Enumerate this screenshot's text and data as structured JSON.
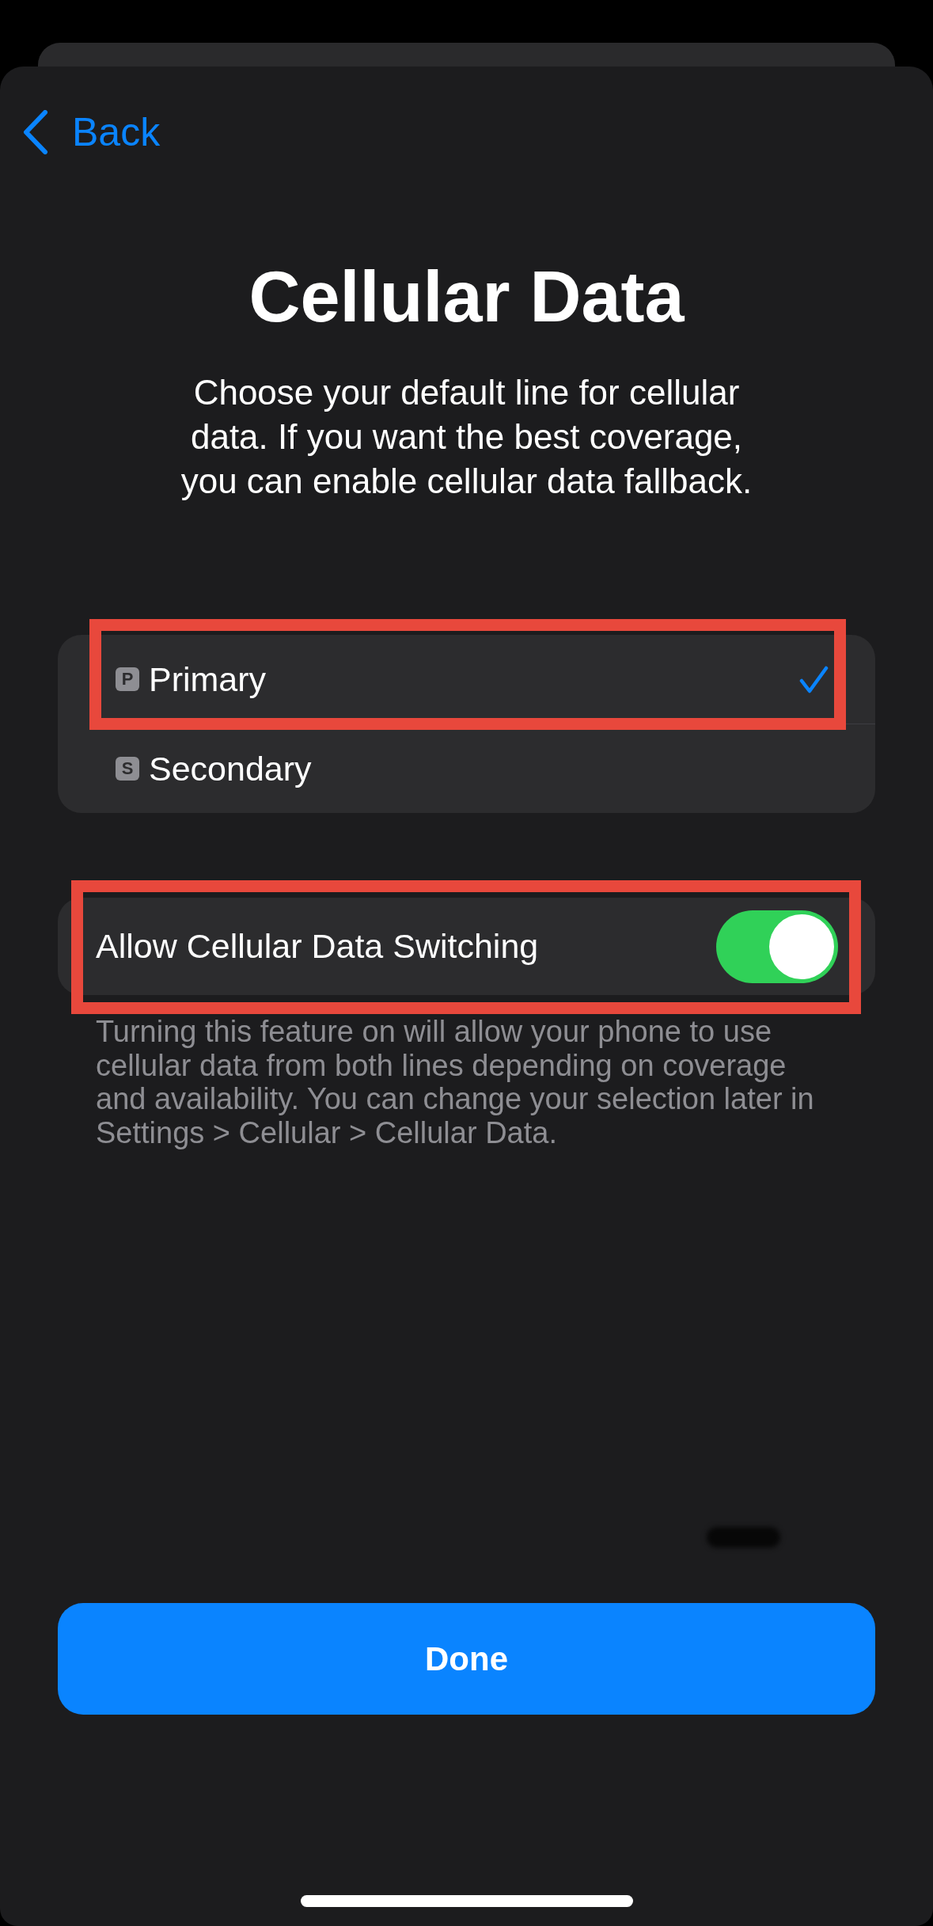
{
  "nav": {
    "back_label": "Back"
  },
  "title": "Cellular Data",
  "subtitle": "Choose your default line for cellular data. If you want the best coverage, you can enable cellular data fallback.",
  "lines": [
    {
      "badge": "P",
      "label": "Primary",
      "selected": true,
      "highlighted": true
    },
    {
      "badge": "S",
      "label": "Secondary",
      "selected": false,
      "highlighted": false
    }
  ],
  "fallback": {
    "label": "Allow Cellular Data Switching",
    "on": true,
    "highlighted": true
  },
  "footer": "Turning this feature on will allow your phone to use cellular data from both lines depending on coverage and availability. You can change your selection later in Settings > Cellular > Cellular Data.",
  "done_button": {
    "label": "Done"
  }
}
